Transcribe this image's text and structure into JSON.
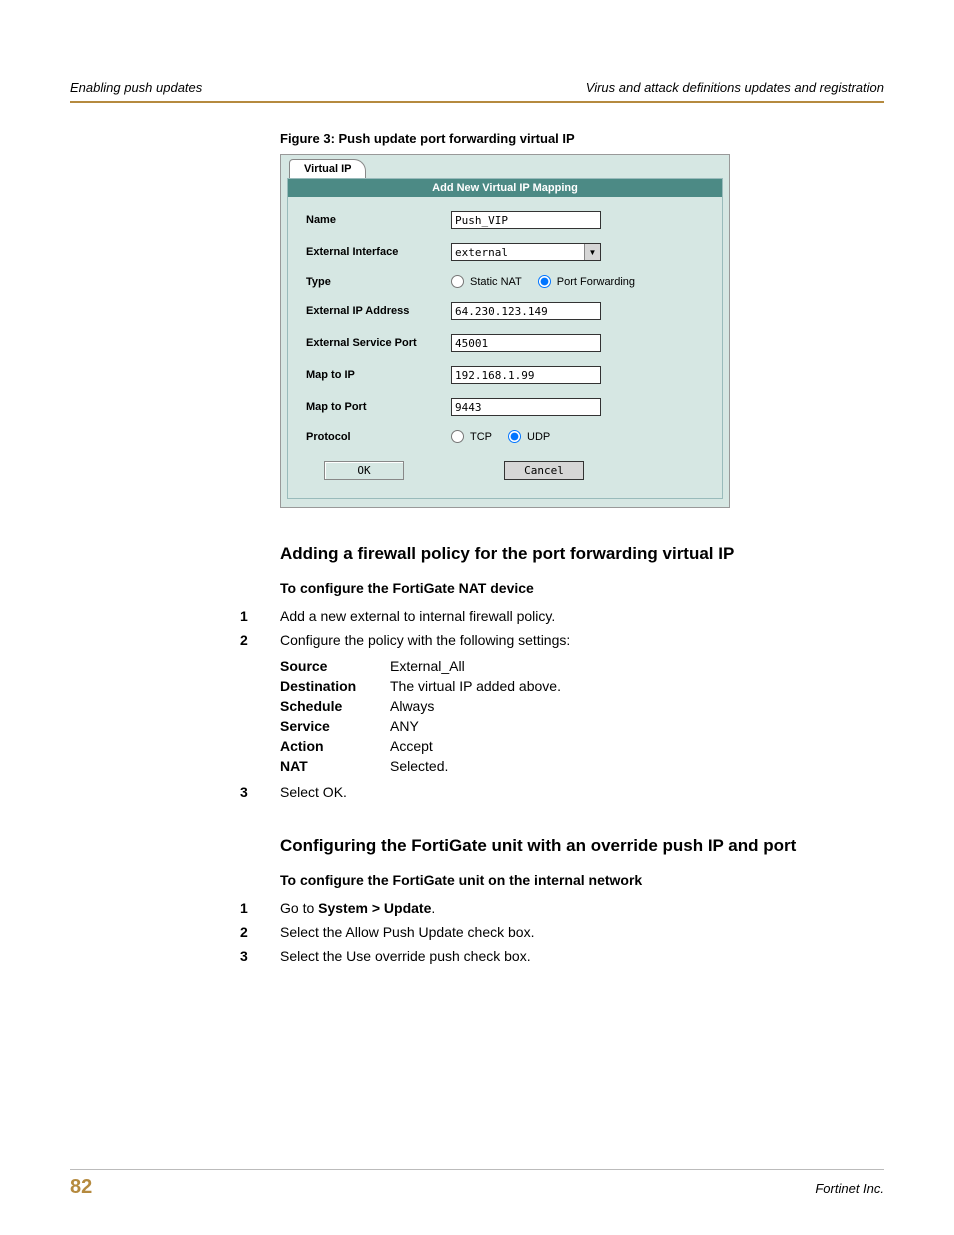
{
  "header": {
    "left": "Enabling push updates",
    "right": "Virus and attack definitions updates and registration"
  },
  "figure_caption": "Figure 3:   Push update port forwarding virtual IP",
  "screenshot": {
    "tab": "Virtual IP",
    "panel_title": "Add New Virtual IP Mapping",
    "fields": {
      "name": {
        "label": "Name",
        "value": "Push_VIP"
      },
      "ext_if": {
        "label": "External Interface",
        "value": "external"
      },
      "type": {
        "label": "Type",
        "opt1": "Static NAT",
        "opt2": "Port Forwarding",
        "selected": "Port Forwarding"
      },
      "ext_ip": {
        "label": "External IP Address",
        "value": "64.230.123.149"
      },
      "ext_port": {
        "label": "External Service Port",
        "value": "45001"
      },
      "map_ip": {
        "label": "Map to IP",
        "value": "192.168.1.99"
      },
      "map_port": {
        "label": "Map to Port",
        "value": "9443"
      },
      "protocol": {
        "label": "Protocol",
        "opt1": "TCP",
        "opt2": "UDP",
        "selected": "UDP"
      }
    },
    "buttons": {
      "ok": "OK",
      "cancel": "Cancel"
    }
  },
  "section1": {
    "heading": "Adding a firewall policy for the port forwarding virtual IP",
    "sub": "To configure the FortiGate NAT device",
    "steps": [
      "Add a new external to internal firewall policy.",
      "Configure the policy with the following settings:",
      "Select OK."
    ],
    "settings": [
      {
        "k": "Source",
        "v": "External_All"
      },
      {
        "k": "Destination",
        "v": "The virtual IP added above."
      },
      {
        "k": "Schedule",
        "v": "Always"
      },
      {
        "k": "Service",
        "v": "ANY"
      },
      {
        "k": "Action",
        "v": "Accept"
      },
      {
        "k": "NAT",
        "v": "Selected."
      }
    ]
  },
  "section2": {
    "heading": "Configuring the FortiGate unit with an override push IP and port",
    "sub": "To configure the FortiGate unit on the internal network",
    "steps": {
      "s1_pre": "Go to ",
      "s1_bold": "System > Update",
      "s1_post": ".",
      "s2": "Select the Allow Push Update check box.",
      "s3": "Select the Use override push check box."
    }
  },
  "footer": {
    "page": "82",
    "company": "Fortinet Inc."
  }
}
